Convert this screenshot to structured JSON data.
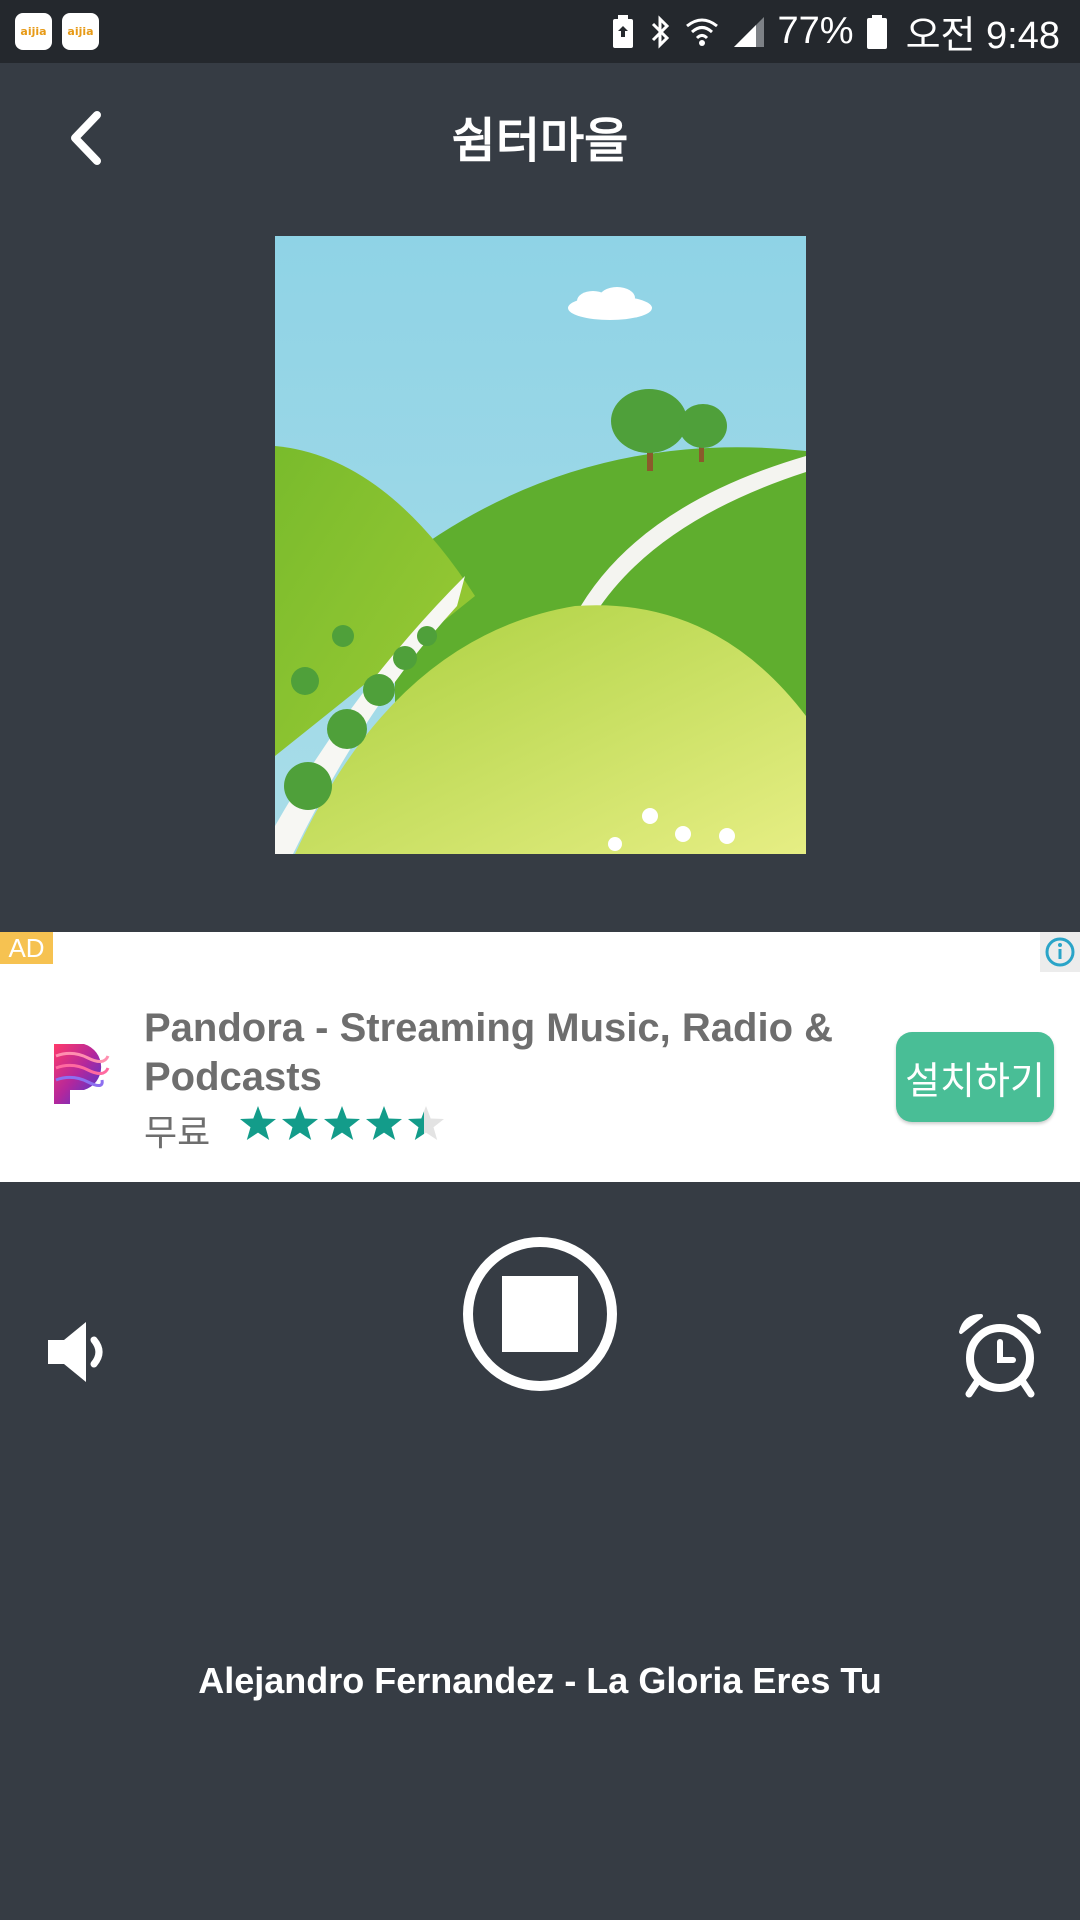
{
  "status_bar": {
    "app_badges": [
      "aijia",
      "aijia"
    ],
    "battery_percent": "77%",
    "time": "오전 9:48"
  },
  "header": {
    "title": "쉼터마을",
    "back_icon": "chevron-left-icon"
  },
  "album_art": {
    "icon": "landscape-illustration"
  },
  "ad": {
    "label": "AD",
    "title": "Pandora - Streaming Music, Radio & Podcasts",
    "price": "무료",
    "rating": 4.5,
    "rating_max": 5,
    "install_label": "설치하기",
    "accent_color": "#49be96",
    "star_color": "#139c8a"
  },
  "controls": {
    "volume_icon": "speaker-icon",
    "stop_icon": "stop-icon",
    "alarm_icon": "alarm-clock-icon"
  },
  "now_playing": {
    "track": "Alejandro Fernandez - La Gloria Eres Tu"
  }
}
